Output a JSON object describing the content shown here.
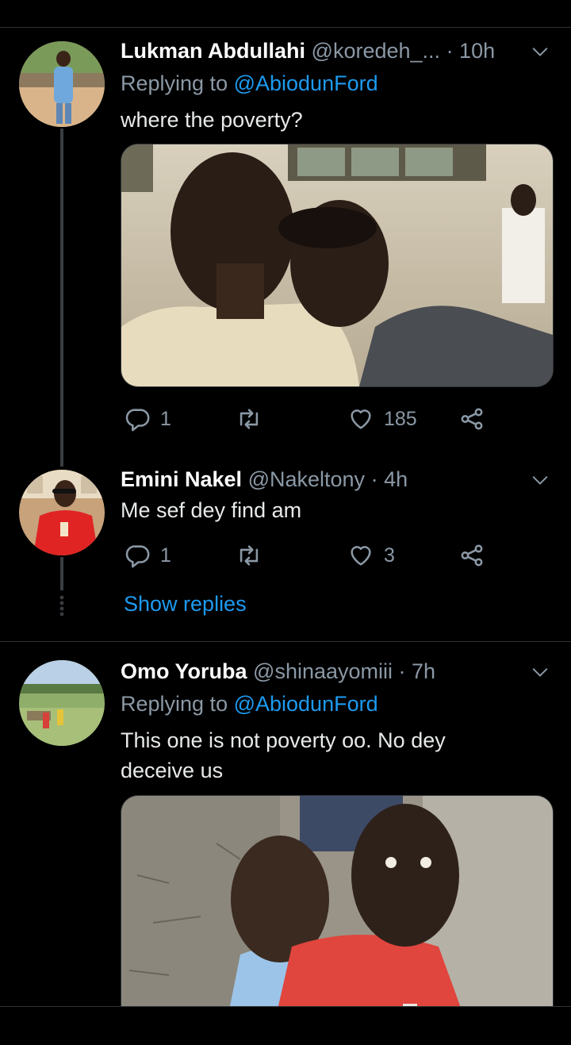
{
  "tweets": [
    {
      "name": "Lukman Abdullahi",
      "handle": "@koredeh_...",
      "time": "· 10h",
      "replying_prefix": "Replying to ",
      "replying_to": "@AbiodunFord",
      "text": "where the poverty?",
      "replies": "1",
      "likes": "185"
    },
    {
      "name": "Emini Nakel",
      "handle": "@Nakeltony",
      "time": "· 4h",
      "text": "Me sef dey find am",
      "replies": "1",
      "likes": "3",
      "show_replies": "Show replies"
    },
    {
      "name": "Omo Yoruba",
      "handle": "@shinaayomiii",
      "time": "· 7h",
      "replying_prefix": "Replying to ",
      "replying_to": "@AbiodunFord",
      "text_line1": "This one is not poverty oo. No dey",
      "text_line2": "deceive us"
    }
  ],
  "colors": {
    "background": "#000000",
    "accent": "#1d9bf0",
    "muted": "#8b98a5",
    "divider": "#2f3336"
  },
  "icons": [
    "reply-icon",
    "retweet-icon",
    "like-icon",
    "share-icon",
    "chevron-down-icon"
  ]
}
